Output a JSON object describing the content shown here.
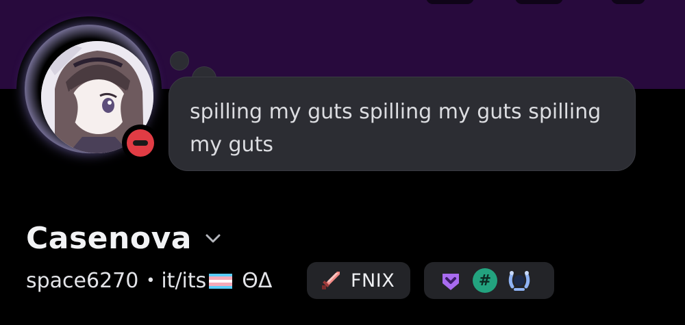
{
  "profile": {
    "custom_status": "spilling my guts spilling my guts spilling my guts",
    "display_name": "Casenova",
    "username": "space6270",
    "separator": "•",
    "pronouns": "it/its",
    "pronoun_suffix": "ΘΔ",
    "status": "dnd",
    "status_icon": "do-not-disturb-icon",
    "flag_icon": "trans-flag-icon",
    "flag_colors": [
      "#5bcefa",
      "#f5a9b8",
      "#ffffff",
      "#f5a9b8",
      "#5bcefa"
    ]
  },
  "guild_tag": {
    "icon": "pixel-sword-icon",
    "label": "FNIX"
  },
  "badges": [
    {
      "icon": "nitro-badge-icon"
    },
    {
      "icon": "hashtag-badge-icon",
      "text": "#"
    },
    {
      "icon": "laurel-badge-icon"
    }
  ],
  "colors": {
    "banner": "#280a3d",
    "background": "#000000",
    "bubble": "#2c2d33",
    "dnd_red": "#e13c44",
    "nitro_purple": "#a86bf0",
    "hashtag_green": "#23a37f",
    "laurel_blue": "#8fb3f5"
  }
}
